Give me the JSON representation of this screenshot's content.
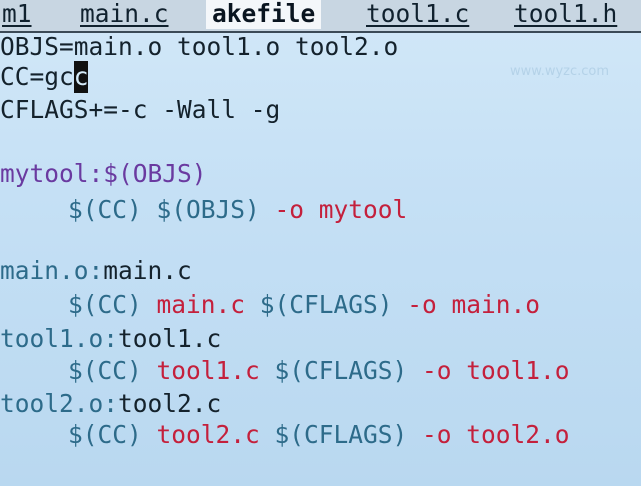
{
  "tabs": [
    {
      "label": "m1",
      "active": false
    },
    {
      "label": "main.c",
      "active": false
    },
    {
      "label": "akefile",
      "active": true
    },
    {
      "label": "tool1.c",
      "active": false
    },
    {
      "label": "tool1.h",
      "active": false
    }
  ],
  "lines": {
    "objs": "OBJS=main.o tool1.o tool2.o",
    "cc_pre": "CC=gc",
    "cc_cursor": "c",
    "cflags": "CFLAGS+=-c -Wall -g",
    "mytool_target": "mytool:",
    "mytool_dep": "$(OBJS)",
    "mytool_cmd_a": "$(CC) $(OBJS) ",
    "mytool_cmd_b": "-o mytool",
    "main_target": "main.o:",
    "main_dep": "main.c",
    "main_cmd_a": "$(CC) ",
    "main_cmd_b": "main.c ",
    "main_cmd_c": "$(CFLAGS) ",
    "main_cmd_d": "-o main.o",
    "tool1_target": "tool1.o:",
    "tool1_dep": "tool1.c",
    "tool1_cmd_a": "$(CC) ",
    "tool1_cmd_b": "tool1.c ",
    "tool1_cmd_c": "$(CFLAGS) ",
    "tool1_cmd_d": "-o tool1.o",
    "tool2_target": "tool2.o:",
    "tool2_dep": "tool2.c",
    "tool2_cmd_a": "$(CC) ",
    "tool2_cmd_b": "tool2.c ",
    "tool2_cmd_c": "$(CFLAGS) ",
    "tool2_cmd_d": "-o tool2.o"
  },
  "watermark": {
    "url": "www.wyzc.com"
  }
}
